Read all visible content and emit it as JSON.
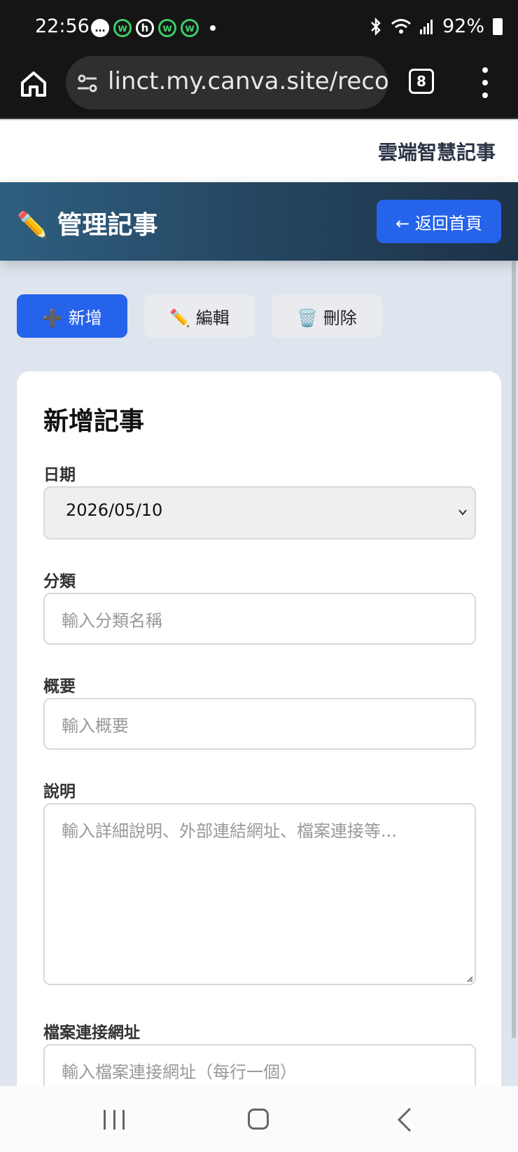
{
  "status_bar": {
    "time": "22:56",
    "battery": "92%",
    "icons": [
      "chat-bubble-icon",
      "w-app-icon",
      "h-app-icon",
      "w-app-icon",
      "w-app-icon",
      "bluetooth-icon",
      "wifi-icon",
      "signal-icon",
      "battery-icon"
    ]
  },
  "browser": {
    "url": "linct.my.canva.site/record",
    "tab_count": "8"
  },
  "site": {
    "brand": "雲端智慧記事"
  },
  "page": {
    "title": "✏️ 管理記事",
    "back_button": "← 返回首頁"
  },
  "actions": {
    "add": "➕ 新增",
    "edit": "✏️ 編輯",
    "delete": "🗑️ 刪除"
  },
  "form": {
    "heading": "新增記事",
    "date_label": "日期",
    "date_value": "2026/05/10",
    "category_label": "分類",
    "category_placeholder": "輸入分類名稱",
    "summary_label": "概要",
    "summary_placeholder": "輸入概要",
    "description_label": "說明",
    "description_placeholder": "輸入詳細說明、外部連結網址、檔案連接等...",
    "file_url_label": "檔案連接網址",
    "file_url_placeholder": "輸入檔案連接網址（每行一個）"
  },
  "colors": {
    "primary": "#2563eb",
    "header_gradient_start": "#2f5f80",
    "header_gradient_end": "#1d3247"
  }
}
